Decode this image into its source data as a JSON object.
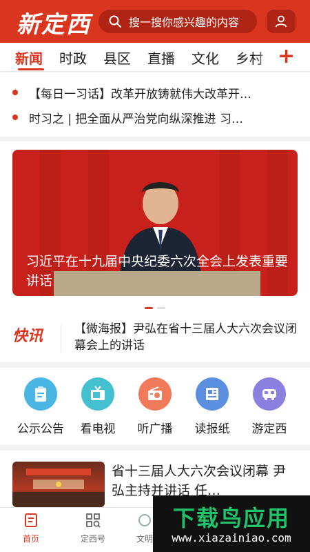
{
  "app": {
    "logo": "新定西"
  },
  "search": {
    "placeholder": "搜一搜你感兴趣的内容"
  },
  "tabs": [
    {
      "label": "新闻",
      "active": true
    },
    {
      "label": "时政"
    },
    {
      "label": "县区"
    },
    {
      "label": "直播"
    },
    {
      "label": "文化"
    },
    {
      "label": "乡村"
    }
  ],
  "headlines": [
    "【每日一习话】改革开放铸就伟大改革开…",
    "时习之 | 把全面从严治党向纵深推进 习…"
  ],
  "banner": {
    "caption": "习近平在十九届中央纪委六次全会上发表重要讲话"
  },
  "flash": {
    "logo": "快讯",
    "text": "【微海报】尹弘在省十三届人大六次会议闭幕会上的讲话"
  },
  "quick_entries": [
    {
      "label": "公示公告",
      "icon": "notice-icon",
      "color": "#4ab6e6"
    },
    {
      "label": "看电视",
      "icon": "tv-icon",
      "color": "#45c0d0"
    },
    {
      "label": "听广播",
      "icon": "radio-icon",
      "color": "#f07a5a"
    },
    {
      "label": "读报纸",
      "icon": "newspaper-icon",
      "color": "#5a8fe0"
    },
    {
      "label": "游定西",
      "icon": "bus-icon",
      "color": "#8b7fe0"
    }
  ],
  "news": {
    "title": "省十三届人大六次会议闭幕 尹弘主持并讲话 任…"
  },
  "bottom_nav": [
    {
      "label": "首页",
      "icon": "home-icon",
      "active": true
    },
    {
      "label": "定西号",
      "icon": "grid-search-icon"
    },
    {
      "label": "文明",
      "icon": "civilization-icon"
    }
  ],
  "watermark": {
    "title": "下载鸟应用",
    "url": "www.xiazainiao.com"
  },
  "colors": {
    "brand": "#d9351f"
  }
}
